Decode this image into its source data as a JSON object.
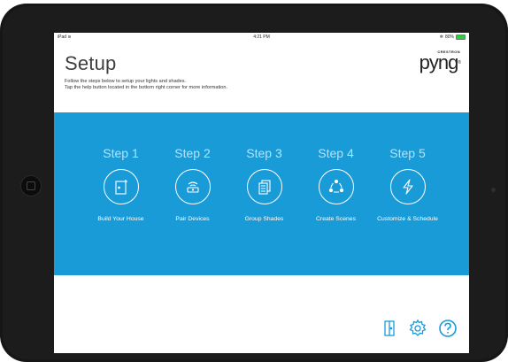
{
  "status": {
    "carrier": "iPad",
    "wifi_glyph": "≋",
    "time": "4:21 PM",
    "bluetooth_glyph": "✲",
    "battery": "80%"
  },
  "header": {
    "title": "Setup",
    "instructions_line1": "Follow the steps below to setup your lights and shades.",
    "instructions_line2": "Tap the help button located in the bottom right corner for more information."
  },
  "logo": {
    "top": "CRESTRON",
    "main": "pyng",
    "mark": "®"
  },
  "steps": [
    {
      "title": "Step 1",
      "label": "Build Your House",
      "icon": "door-icon"
    },
    {
      "title": "Step 2",
      "label": "Pair Devices",
      "icon": "router-icon"
    },
    {
      "title": "Step 3",
      "label": "Group Shades",
      "icon": "shades-icon"
    },
    {
      "title": "Step 4",
      "label": "Create Scenes",
      "icon": "scenes-icon"
    },
    {
      "title": "Step 5",
      "label": "Customize & Schedule",
      "icon": "lightning-icon"
    }
  ],
  "toolbar": {
    "icons": [
      "house-icon",
      "settings-gear-icon",
      "help-icon"
    ]
  },
  "colors": {
    "panel": "#199bd8",
    "step_title": "#b7e2f6",
    "toolbar_icon": "#199bd8"
  }
}
